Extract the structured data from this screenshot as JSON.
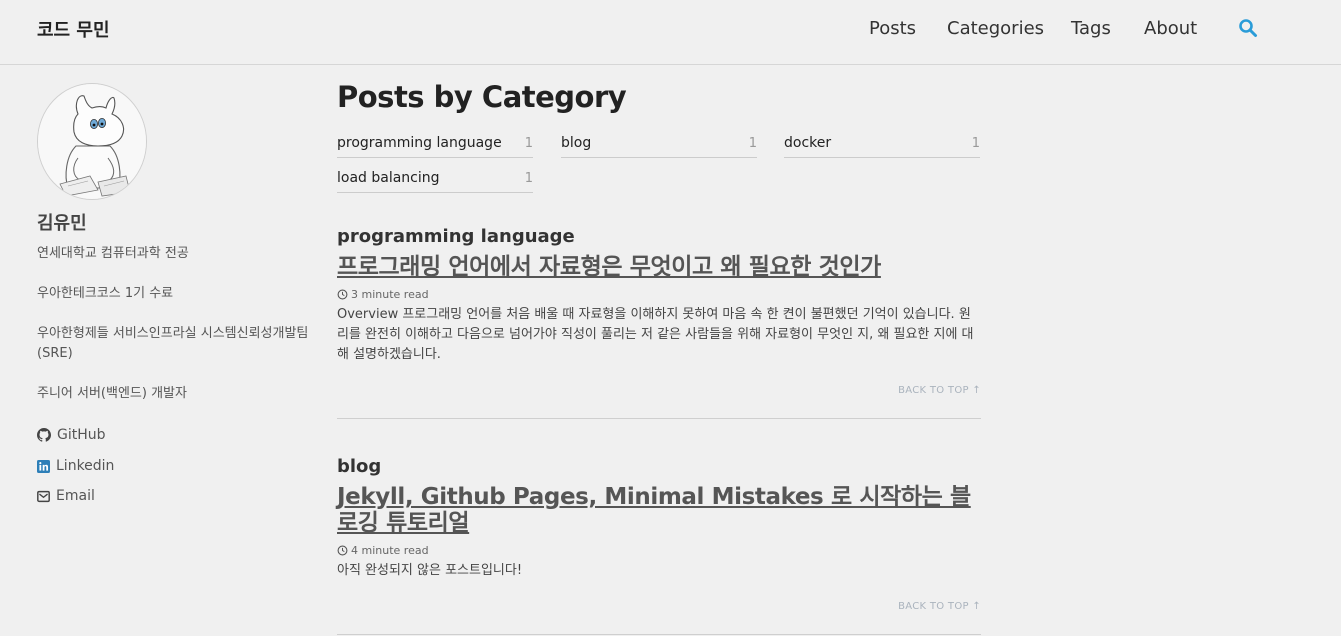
{
  "site": {
    "title": "코드 무민"
  },
  "nav": {
    "items": [
      "Posts",
      "Categories",
      "Tags",
      "About"
    ],
    "search_icon": "search-icon",
    "accent": "#2a9cd8"
  },
  "author": {
    "name": "김유민",
    "bio": [
      "연세대학교 컴퓨터과학 전공",
      "우아한테크코스 1기 수료",
      "우아한형제들 서비스인프라실 시스템신뢰성개발팀(SRE)",
      "주니어 서버(백엔드) 개발자"
    ],
    "links": [
      {
        "icon": "github-icon",
        "label": "GitHub"
      },
      {
        "icon": "linkedin-icon",
        "label": "Linkedin"
      },
      {
        "icon": "email-icon",
        "label": "Email"
      }
    ]
  },
  "page": {
    "title": "Posts by Category"
  },
  "taxonomy": [
    {
      "name": "programming language",
      "count": "1"
    },
    {
      "name": "blog",
      "count": "1"
    },
    {
      "name": "docker",
      "count": "1"
    },
    {
      "name": "load balancing",
      "count": "1"
    }
  ],
  "sections": [
    {
      "title": "programming language",
      "post": {
        "title": "프로그래밍 언어에서 자료형은 무엇이고 왜 필요한 것인가",
        "read_time": "3 minute read",
        "excerpt": "Overview 프로그래밍 언어를 처음 배울 때 자료형을 이해하지 못하여 마음 속 한 켠이 불편했던 기억이 있습니다. 원리를 완전히 이해하고 다음으로 넘어가야 직성이 풀리는 저 같은 사람들을 위해 자료형이 무엇인 지, 왜 필요한 지에 대해 설명하겠습니다."
      },
      "back_to_top": "BACK TO TOP ↑"
    },
    {
      "title": "blog",
      "post": {
        "title": "Jekyll, Github Pages, Minimal Mistakes 로 시작하는 블로깅 튜토리얼",
        "read_time": "4 minute read",
        "excerpt": "아직 완성되지 않은 포스트입니다!"
      },
      "back_to_top": "BACK TO TOP ↑"
    }
  ]
}
